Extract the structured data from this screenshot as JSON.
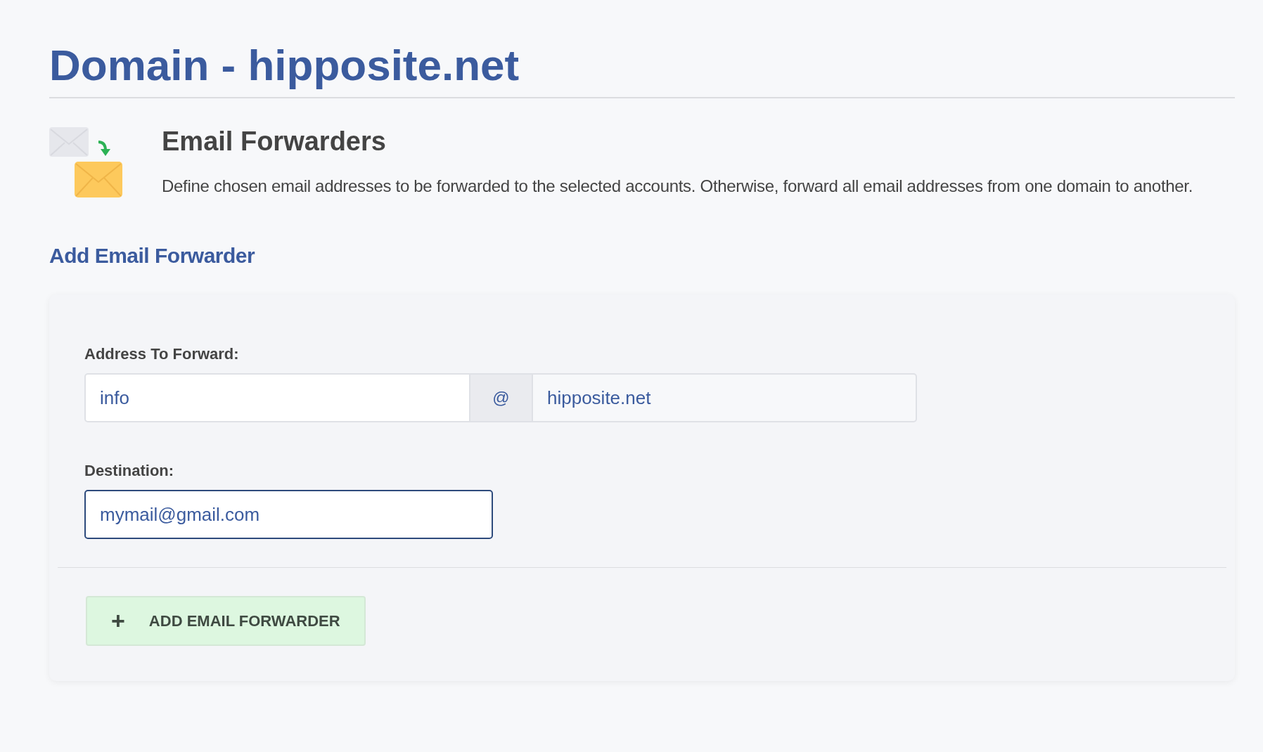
{
  "page_title": "Domain - hipposite.net",
  "intro": {
    "heading": "Email Forwarders",
    "description": "Define chosen email addresses to be forwarded to the selected accounts. Otherwise, forward all email addresses from one domain to another."
  },
  "section_title": "Add Email Forwarder",
  "form": {
    "address_label": "Address To Forward:",
    "address_value": "info",
    "at_sign": "@",
    "domain_value": "hipposite.net",
    "destination_label": "Destination:",
    "destination_value": "mymail@gmail.com",
    "destination_focused": true
  },
  "submit_button": {
    "icon": "+",
    "label": "ADD EMAIL FORWARDER"
  }
}
